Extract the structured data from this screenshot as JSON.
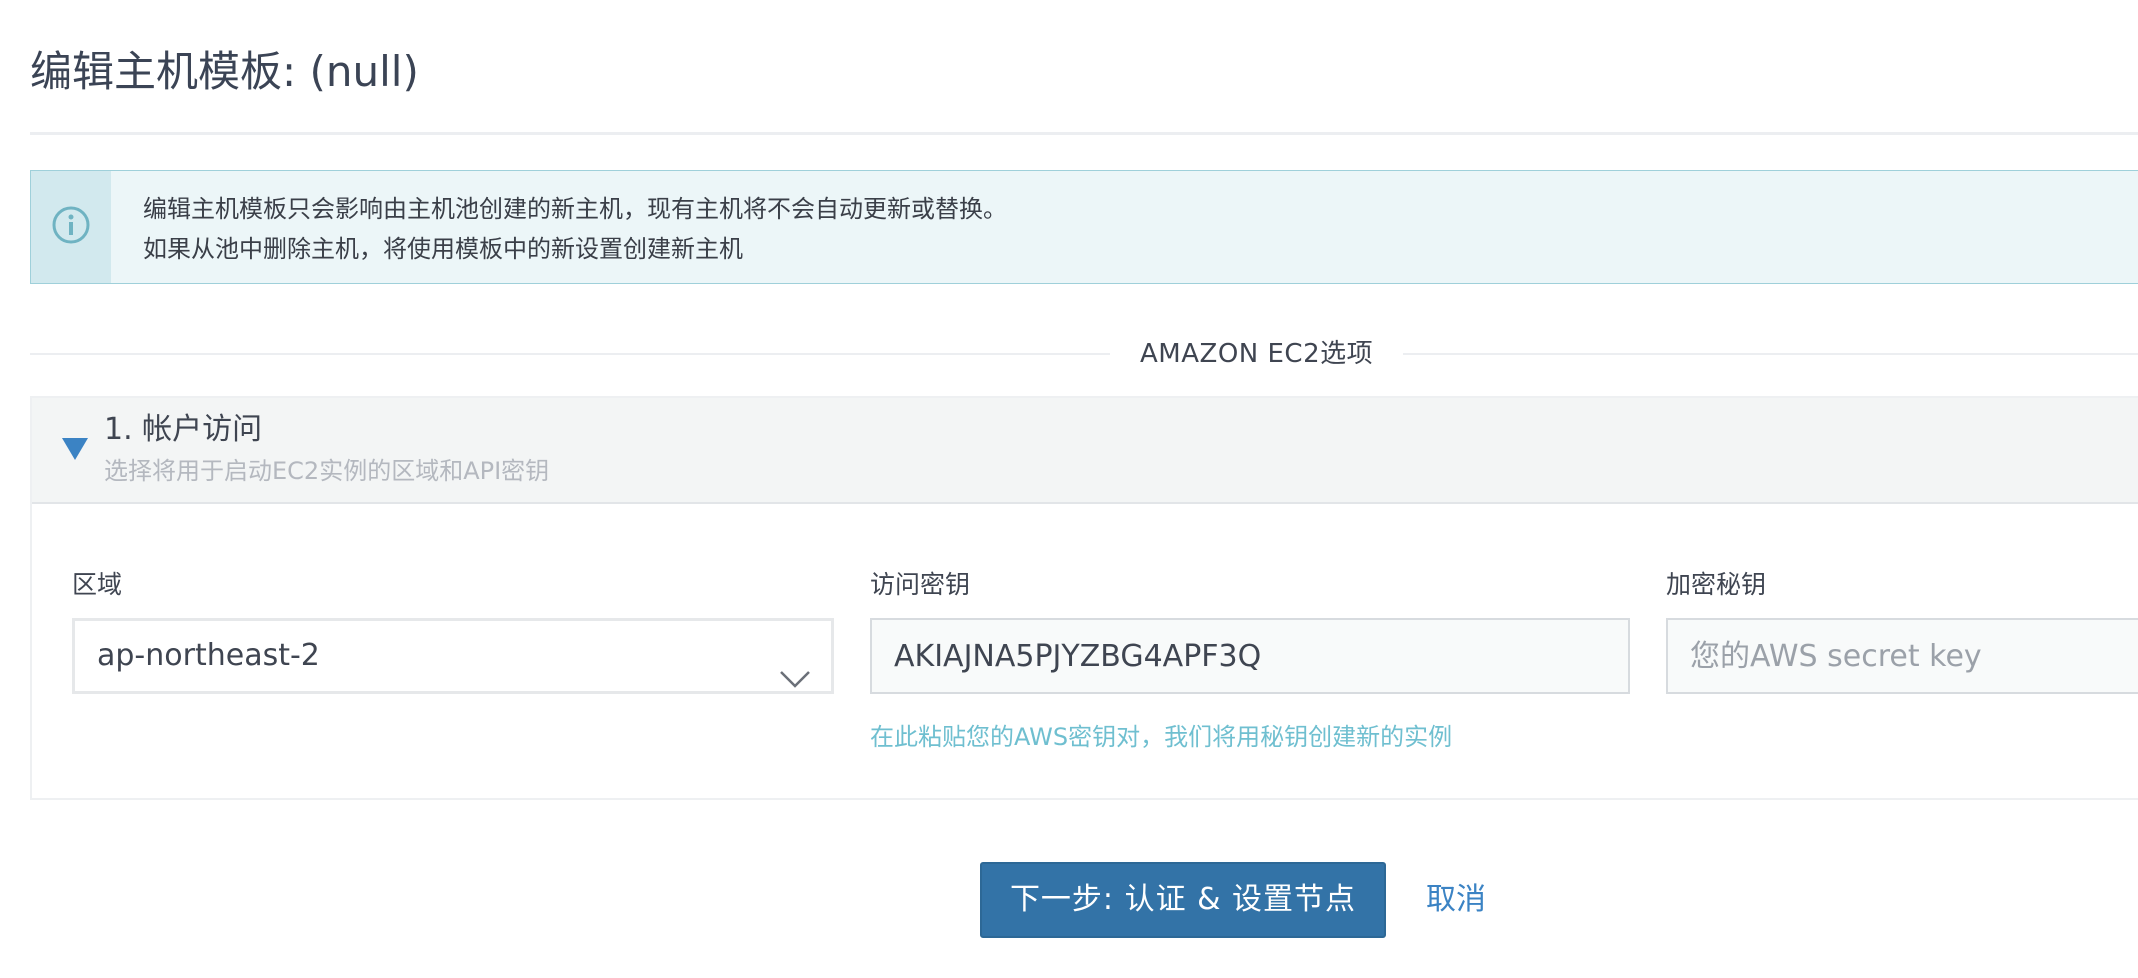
{
  "page": {
    "title": "编辑主机模板: (null)"
  },
  "info_banner": {
    "icon": "info-icon",
    "line1": "编辑主机模板只会影响由主机池创建的新主机，现有主机将不会自动更新或替换。",
    "line2": "如果从池中删除主机，将使用模板中的新设置创建新主机"
  },
  "section": {
    "title": "AMAZON EC2选项"
  },
  "account_access": {
    "title": "1. 帐户访问",
    "subtitle": "选择将用于启动EC2实例的区域和API密钥",
    "expanded": true
  },
  "fields": {
    "region": {
      "label": "区域",
      "value": "ap-northeast-2"
    },
    "access_key": {
      "label": "访问密钥",
      "value": "AKIAJNA5PJYZBG4APF3Q",
      "help": "在此粘贴您的AWS密钥对，我们将用秘钥创建新的实例"
    },
    "secret_key": {
      "label": "加密秘钥",
      "value": "",
      "placeholder": "您的AWS secret key"
    }
  },
  "actions": {
    "next_label": "下一步: 认证 & 设置节点",
    "cancel_label": "取消"
  },
  "colors": {
    "primary": "#3373a7",
    "link": "#3b83c4",
    "info_bg": "#ecf6f8",
    "info_border": "#9fd0da",
    "help_text": "#6fbfd0"
  }
}
